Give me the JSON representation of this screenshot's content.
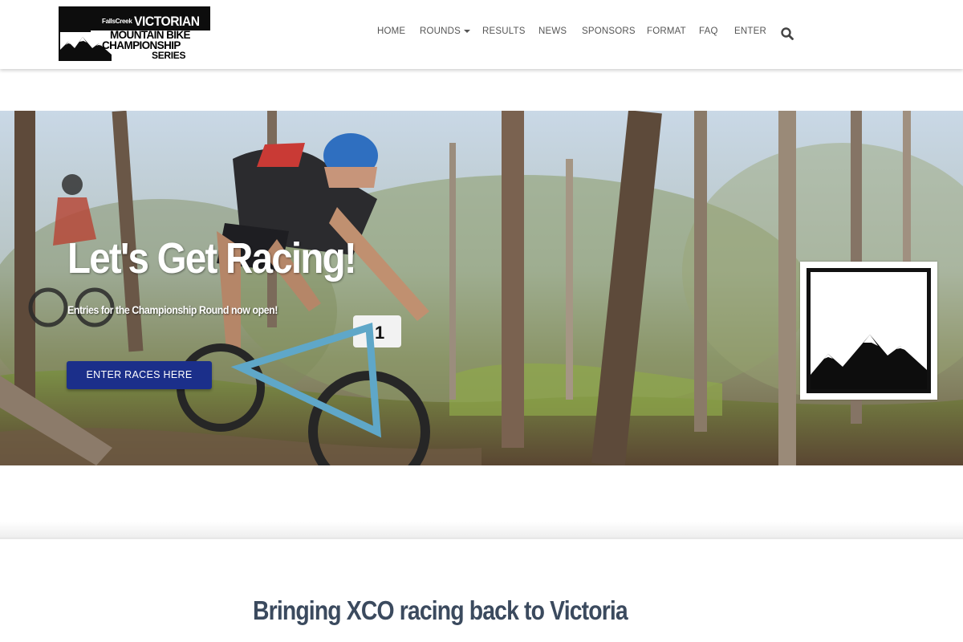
{
  "logo": {
    "brand": "FallsCreek",
    "line1": "VICTORIAN",
    "line2": "MOUNTAIN BIKE",
    "line3": "CHAMPIONSHIP",
    "line4": "SERIES"
  },
  "nav": {
    "items": [
      {
        "label": "HOME"
      },
      {
        "label": "ROUNDS",
        "dropdown": true
      },
      {
        "label": "RESULTS"
      },
      {
        "label": "NEWS"
      },
      {
        "label": "SPONSORS"
      },
      {
        "label": "FORMAT"
      },
      {
        "label": "FAQ"
      },
      {
        "label": "ENTER"
      }
    ],
    "search_icon": "search-icon"
  },
  "hero": {
    "title": "Let's Get Racing!",
    "subtitle": "Entries for the Championship Round now open!",
    "button_label": "ENTER RACES HERE",
    "button_color": "#1b2f8a",
    "badge_icon": "mountain-icon",
    "rider_number": "1"
  },
  "section": {
    "heading": "Bringing XCO racing back to Victoria",
    "heading_color": "#3b4a5e"
  }
}
